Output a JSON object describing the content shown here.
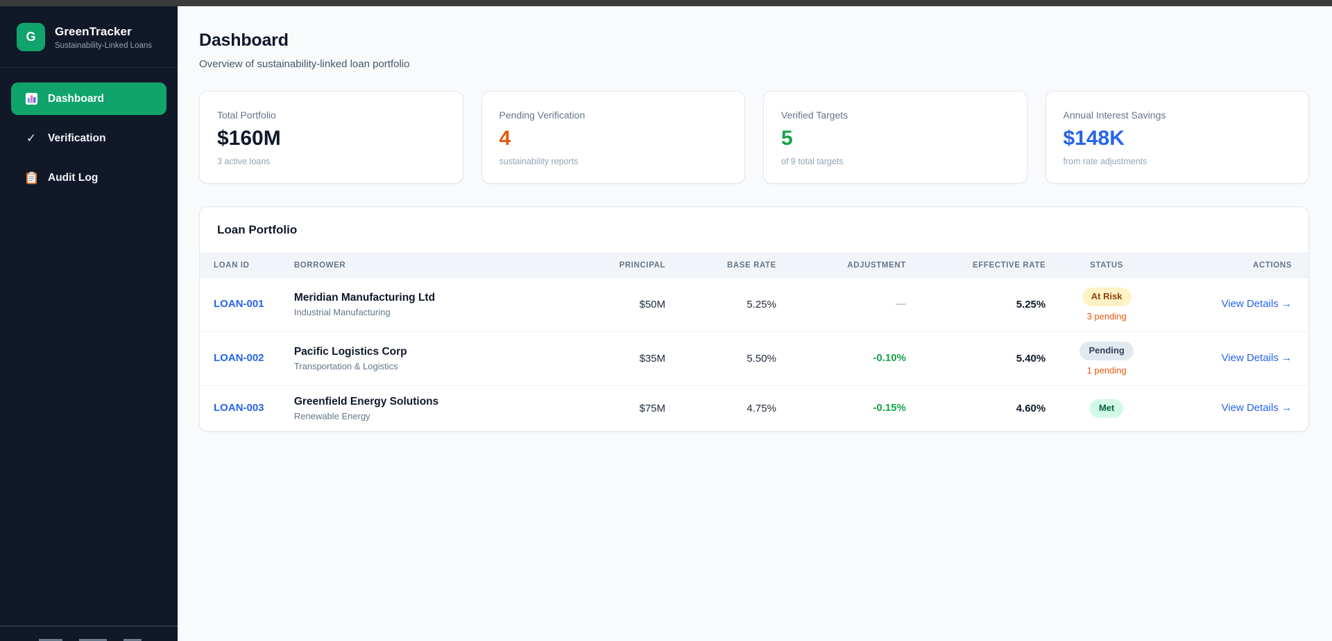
{
  "sidebar": {
    "brand": {
      "logo_letter": "G",
      "title": "GreenTracker",
      "subtitle": "Sustainability-Linked Loans"
    },
    "nav": [
      {
        "label": "Dashboard",
        "icon": "bar-chart-icon",
        "active": true
      },
      {
        "label": "Verification",
        "icon": "checkmark-icon",
        "active": false
      },
      {
        "label": "Audit Log",
        "icon": "clipboard-icon",
        "active": false
      }
    ]
  },
  "header": {
    "title": "Dashboard",
    "subtitle": "Overview of sustainability-linked loan portfolio"
  },
  "stats": [
    {
      "label": "Total Portfolio",
      "value": "$160M",
      "sub": "3 active loans",
      "value_color": "#0f172a"
    },
    {
      "label": "Pending Verification",
      "value": "4",
      "sub": "sustainability reports",
      "value_color": "#ea580c"
    },
    {
      "label": "Verified Targets",
      "value": "5",
      "sub": "of 9 total targets",
      "value_color": "#16a34a"
    },
    {
      "label": "Annual Interest Savings",
      "value": "$148K",
      "sub": "from rate adjustments",
      "value_color": "#2563eb"
    }
  ],
  "portfolio": {
    "title": "Loan Portfolio",
    "columns": {
      "loan_id": "LOAN ID",
      "borrower": "BORROWER",
      "principal": "PRINCIPAL",
      "base_rate": "BASE RATE",
      "adjustment": "ADJUSTMENT",
      "effective_rate": "EFFECTIVE RATE",
      "status": "STATUS",
      "actions": "ACTIONS"
    },
    "action_label": "View Details →",
    "rows": [
      {
        "loan_id": "LOAN-001",
        "borrower": "Meridian Manufacturing Ltd",
        "sector": "Industrial Manufacturing",
        "principal": "$50M",
        "base_rate": "5.25%",
        "adjustment": "—",
        "effective_rate": "5.25%",
        "status": "At Risk",
        "pending_note": "3 pending"
      },
      {
        "loan_id": "LOAN-002",
        "borrower": "Pacific Logistics Corp",
        "sector": "Transportation & Logistics",
        "principal": "$35M",
        "base_rate": "5.50%",
        "adjustment": "-0.10%",
        "effective_rate": "5.40%",
        "status": "Pending",
        "pending_note": "1 pending"
      },
      {
        "loan_id": "LOAN-003",
        "borrower": "Greenfield Energy Solutions",
        "sector": "Renewable Energy",
        "principal": "$75M",
        "base_rate": "4.75%",
        "adjustment": "-0.15%",
        "effective_rate": "4.60%",
        "status": "Met",
        "pending_note": ""
      }
    ]
  },
  "colors": {
    "accent_green": "#10a36c",
    "sidebar_bg": "#111827",
    "orange": "#ea580c",
    "positive_green": "#16a34a",
    "link_blue": "#2563eb",
    "badge_at_risk_bg": "#fef3c7",
    "badge_pending_bg": "#e2e8f0",
    "badge_met_bg": "#d1fae5"
  }
}
